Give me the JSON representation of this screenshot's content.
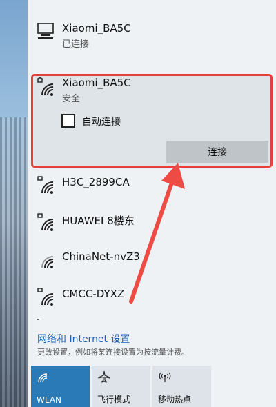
{
  "current_network": {
    "name": "Xiaomi_BA5C",
    "status": "已连接"
  },
  "selected_network": {
    "name": "Xiaomi_BA5C",
    "security": "安全",
    "auto_connect_label": "自动连接",
    "connect_label": "连接"
  },
  "networks": [
    {
      "name": "H3C_2899CA"
    },
    {
      "name": "HUAWEI  8楼东"
    },
    {
      "name": "ChinaNet-nvZ3"
    },
    {
      "name": "CMCC-DYXZ"
    }
  ],
  "settings": {
    "link": "网络和 Internet 设置",
    "description": "更改设置，例如将某连接设置为按流量计费。"
  },
  "quick_actions": [
    {
      "label": "WLAN",
      "icon": "wifi-icon"
    },
    {
      "label": "飞行模式",
      "icon": "airplane-icon"
    },
    {
      "label": "移动热点",
      "icon": "hotspot-icon"
    }
  ],
  "colors": {
    "accent": "#2a7ab8",
    "highlight": "#e5403c",
    "panel": "#eef2f5"
  }
}
